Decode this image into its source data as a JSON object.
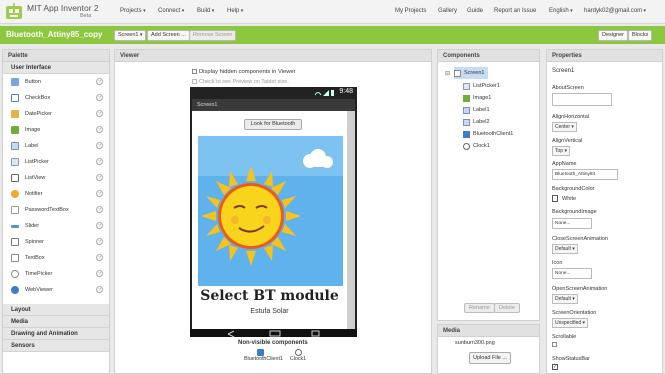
{
  "app": {
    "title": "MIT App Inventor 2",
    "beta": "Beta"
  },
  "topmenu": {
    "left": [
      "Projects",
      "Connect",
      "Build",
      "Help"
    ],
    "my_projects": "My Projects",
    "gallery": "Gallery",
    "guide": "Guide",
    "report": "Report an Issue",
    "language": "English",
    "user": "hardyk02@gmail.com"
  },
  "toolbar": {
    "project": "Bluetooth_Attiny85_copy",
    "screen_select": "Screen1",
    "add_screen": "Add Screen ...",
    "remove_screen": "Remove Screen",
    "designer": "Designer",
    "blocks": "Blocks"
  },
  "palette": {
    "title": "Palette",
    "section": "User Interface",
    "items": [
      "Button",
      "CheckBox",
      "DatePicker",
      "Image",
      "Label",
      "ListPicker",
      "ListView",
      "Notifier",
      "PasswordTextBox",
      "Slider",
      "Spinner",
      "TextBox",
      "TimePicker",
      "WebViewer"
    ],
    "bottom_sections": [
      "Layout",
      "Media",
      "Drawing and Animation",
      "Sensors"
    ],
    "help": "?"
  },
  "viewer": {
    "title": "Viewer",
    "hidden_check": "Display hidden components in Viewer",
    "tablet_check": "Check to see Preview on Tablet size.",
    "phone_time": "9:48",
    "screen_title": "Screen1",
    "button_text": "Look for Bluetooth",
    "big_label": "Select BT module",
    "small_label": "Estufa Solar",
    "nonvisible_title": "Non-visible components",
    "nonvisible": [
      "BluetoothClient1",
      "Clock1"
    ]
  },
  "components": {
    "title": "Components",
    "tree": [
      "Screen1",
      "ListPicker1",
      "Image1",
      "Label1",
      "Label2",
      "BluetoothClient1",
      "Clock1"
    ],
    "rename": "Rename",
    "delete": "Delete"
  },
  "media": {
    "title": "Media",
    "file": "sunburn300.png",
    "upload": "Upload File ..."
  },
  "properties": {
    "title": "Properties",
    "component": "Screen1",
    "about_label": "AboutScreen",
    "align_h_label": "AlignHorizontal",
    "align_h_value": "Center",
    "align_v_label": "AlignVertical",
    "align_v_value": "Top",
    "appname_label": "AppName",
    "appname_value": "Bluetooth_Attiny84",
    "bgcolor_label": "BackgroundColor",
    "bgcolor_value": "White",
    "bgimage_label": "BackgroundImage",
    "bgimage_value": "None...",
    "closeanim_label": "CloseScreenAnimation",
    "closeanim_value": "Default",
    "icon_label": "Icon",
    "icon_value": "None...",
    "openanim_label": "OpenScreenAnimation",
    "openanim_value": "Default",
    "orient_label": "ScreenOrientation",
    "orient_value": "Unspecified",
    "scrollable_label": "Scrollable",
    "statusbar_label": "ShowStatusBar"
  },
  "colors": {
    "green": "#8dc63f",
    "header": "#e1e1e1"
  }
}
